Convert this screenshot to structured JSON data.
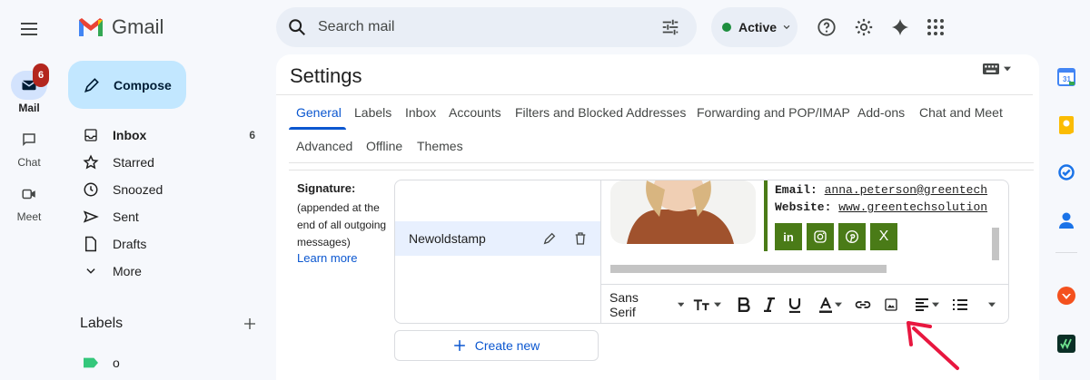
{
  "app": {
    "logo_text": "Gmail"
  },
  "rail": {
    "mail": {
      "label": "Mail",
      "badge": "6"
    },
    "chat": {
      "label": "Chat"
    },
    "meet": {
      "label": "Meet"
    }
  },
  "compose": {
    "label": "Compose"
  },
  "nav": {
    "items": [
      {
        "label": "Inbox",
        "count": "6"
      },
      {
        "label": "Starred"
      },
      {
        "label": "Snoozed"
      },
      {
        "label": "Sent"
      },
      {
        "label": "Drafts"
      },
      {
        "label": "More"
      }
    ],
    "labels_heading": "Labels",
    "labels": [
      {
        "name": "o",
        "color": "#34c77b"
      }
    ]
  },
  "search": {
    "placeholder": "Search mail"
  },
  "status": {
    "label": "Active",
    "color": "#1e8e3e"
  },
  "settings": {
    "title": "Settings",
    "tabs": [
      "General",
      "Labels",
      "Inbox",
      "Accounts",
      "Filters and Blocked Addresses",
      "Forwarding and POP/IMAP",
      "Add-ons",
      "Chat and Meet",
      "Advanced",
      "Offline",
      "Themes"
    ],
    "active_tab": "General"
  },
  "signature": {
    "label": "Signature:",
    "description_lines": [
      "(appended at the",
      "end of all outgoing",
      "messages)"
    ],
    "learn_more": "Learn more",
    "selected_name": "Newoldstamp",
    "preview": {
      "email_label": "Email:",
      "email_value": "anna.peterson@greentech",
      "website_label": "Website:",
      "website_value": "www.greentechsolution",
      "social": [
        "in",
        "ig",
        "p",
        "X"
      ],
      "brand_color": "#4a7b17"
    },
    "toolbar": {
      "font": "Sans Serif"
    },
    "create_new": "Create new"
  }
}
